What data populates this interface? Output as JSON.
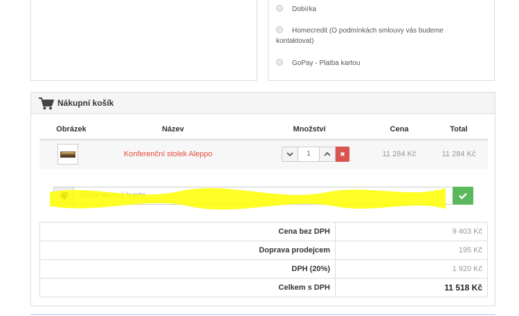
{
  "payment": {
    "options": [
      {
        "label": "Dobírka"
      },
      {
        "label": "Homecredit (O podmínkách smlouvy vás budeme",
        "label_line2": "kontaktovat)"
      },
      {
        "label": "GoPay - Platba kartou"
      }
    ]
  },
  "cart": {
    "title": "Nákupní košík",
    "columns": {
      "image": "Obrázek",
      "name": "Název",
      "quantity": "Množství",
      "price": "Cena",
      "total": "Total"
    },
    "items": [
      {
        "name": "Konferenční stolek Aleppo",
        "quantity": "1",
        "price": "11 284 Kč",
        "total": "11 284 Kč"
      }
    ],
    "coupon": {
      "placeholder": "Vložte slevový kupón"
    },
    "totals": [
      {
        "label": "Cena bez DPH",
        "value": "9 403 Kč"
      },
      {
        "label": "Doprava prodejcem",
        "value": "195 Kč"
      },
      {
        "label": "DPH (20%)",
        "value": "1 920 Kč"
      },
      {
        "label": "Celkem s DPH",
        "value": "11 518 Kč"
      }
    ]
  },
  "colors": {
    "product_link": "#e74c3c",
    "ok_button": "#5cb85c",
    "delete_button": "#d9534f",
    "highlight": "#ffff00"
  }
}
